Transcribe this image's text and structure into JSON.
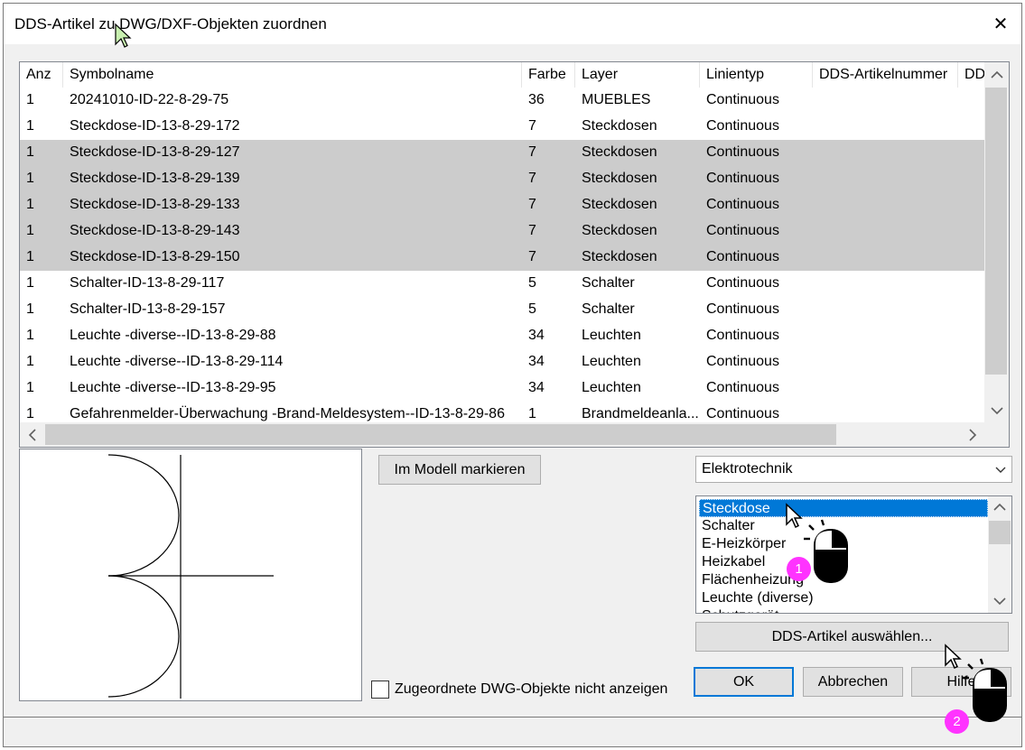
{
  "window": {
    "title": "DDS-Artikel zu DWG/DXF-Objekten zuordnen",
    "close_glyph": "✕"
  },
  "table": {
    "columns": [
      "Anz",
      "Symbolname",
      "Farbe",
      "Layer",
      "Linientyp",
      "DDS-Artikelnummer",
      "DD"
    ],
    "rows": [
      {
        "anz": "1",
        "symbol": "20241010-ID-22-8-29-75",
        "farbe": "36",
        "layer": "MUEBLES",
        "linientyp": "Continuous",
        "selected": false
      },
      {
        "anz": "1",
        "symbol": "Steckdose-ID-13-8-29-172",
        "farbe": "7",
        "layer": "Steckdosen",
        "linientyp": "Continuous",
        "selected": false
      },
      {
        "anz": "1",
        "symbol": "Steckdose-ID-13-8-29-127",
        "farbe": "7",
        "layer": "Steckdosen",
        "linientyp": "Continuous",
        "selected": true
      },
      {
        "anz": "1",
        "symbol": "Steckdose-ID-13-8-29-139",
        "farbe": "7",
        "layer": "Steckdosen",
        "linientyp": "Continuous",
        "selected": true
      },
      {
        "anz": "1",
        "symbol": "Steckdose-ID-13-8-29-133",
        "farbe": "7",
        "layer": "Steckdosen",
        "linientyp": "Continuous",
        "selected": true
      },
      {
        "anz": "1",
        "symbol": "Steckdose-ID-13-8-29-143",
        "farbe": "7",
        "layer": "Steckdosen",
        "linientyp": "Continuous",
        "selected": true
      },
      {
        "anz": "1",
        "symbol": "Steckdose-ID-13-8-29-150",
        "farbe": "7",
        "layer": "Steckdosen",
        "linientyp": "Continuous",
        "selected": true
      },
      {
        "anz": "1",
        "symbol": "Schalter-ID-13-8-29-117",
        "farbe": "5",
        "layer": "Schalter",
        "linientyp": "Continuous",
        "selected": false
      },
      {
        "anz": "1",
        "symbol": "Schalter-ID-13-8-29-157",
        "farbe": "5",
        "layer": "Schalter",
        "linientyp": "Continuous",
        "selected": false
      },
      {
        "anz": "1",
        "symbol": "Leuchte -diverse--ID-13-8-29-88",
        "farbe": "34",
        "layer": "Leuchten",
        "linientyp": "Continuous",
        "selected": false
      },
      {
        "anz": "1",
        "symbol": "Leuchte -diverse--ID-13-8-29-114",
        "farbe": "34",
        "layer": "Leuchten",
        "linientyp": "Continuous",
        "selected": false
      },
      {
        "anz": "1",
        "symbol": "Leuchte -diverse--ID-13-8-29-95",
        "farbe": "34",
        "layer": "Leuchten",
        "linientyp": "Continuous",
        "selected": false
      },
      {
        "anz": "1",
        "symbol": "Gefahrenmelder-Überwachung -Brand-Meldesystem--ID-13-8-29-86",
        "farbe": "1",
        "layer": "Brandmeldeanla...",
        "linientyp": "Continuous",
        "selected": false
      }
    ]
  },
  "buttons": {
    "mark_in_model": "Im Modell markieren",
    "select_article": "DDS-Artikel auswählen...",
    "ok": "OK",
    "cancel": "Abbrechen",
    "help": "Hilfe"
  },
  "category_combo": {
    "selected": "Elektrotechnik"
  },
  "symbol_list": {
    "items": [
      {
        "label": "Steckdose",
        "selected": true
      },
      {
        "label": "Schalter",
        "selected": false
      },
      {
        "label": "E-Heizkörper",
        "selected": false
      },
      {
        "label": "Heizkabel",
        "selected": false
      },
      {
        "label": "Flächenheizung",
        "selected": false
      },
      {
        "label": "Leuchte (diverse)",
        "selected": false
      },
      {
        "label": "Schutzgerät",
        "selected": false
      }
    ]
  },
  "checkbox": {
    "label": "Zugeordnete DWG-Objekte nicht anzeigen",
    "checked": false
  },
  "annotations": {
    "marker_1": "1",
    "marker_2": "2",
    "marker_color": "#ff33ff"
  },
  "colors": {
    "selection_list": "#cccccc",
    "selection_listbox": "#0078d7",
    "default_button_border": "#0078d7"
  }
}
